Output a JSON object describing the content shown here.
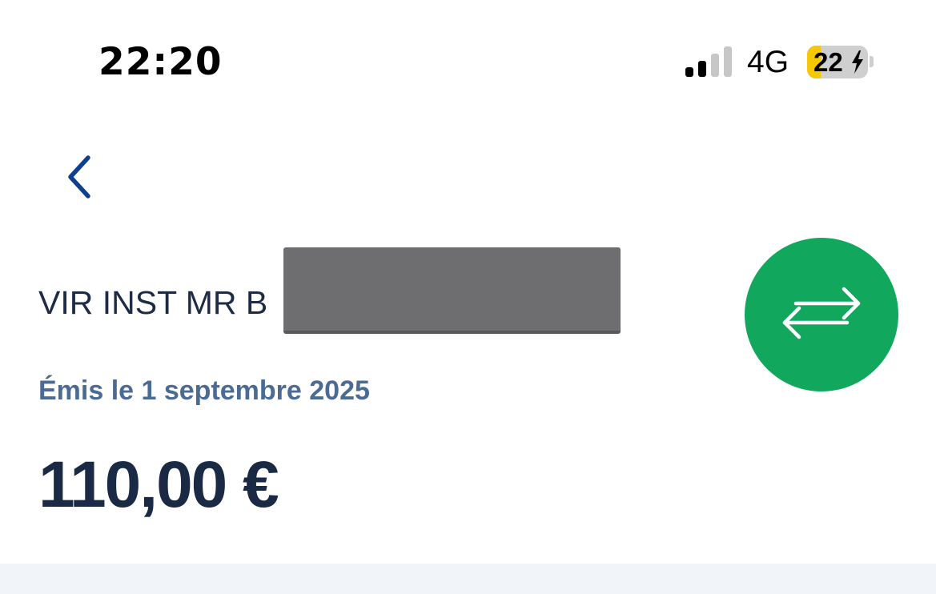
{
  "status_bar": {
    "time": "22:20",
    "network": "4G",
    "signal_bars_active": 2,
    "signal_bars_total": 4,
    "battery_level": 22,
    "battery_label": "22",
    "charging": true,
    "battery_color": "#f6c800"
  },
  "header": {
    "back_icon": "chevron-left-icon",
    "accent_color": "#0f3f8f"
  },
  "transaction": {
    "label_prefix": "VIR INST MR B",
    "issued_text": "Émis le 1 septembre 2025",
    "amount": "110,00 €",
    "type_icon": "transfer-arrows-icon",
    "type_icon_color": "#11a85e"
  }
}
